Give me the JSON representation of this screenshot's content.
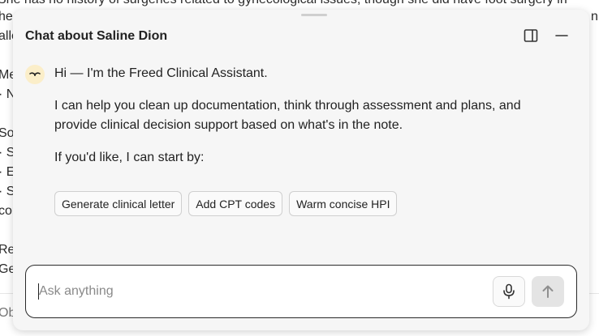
{
  "background": {
    "lines": [
      "She has no history of surgeries related to gynecological issues, though she did have foot surgery in",
      "he",
      "n",
      "alle",
      "Me",
      "· N",
      "So",
      "· S",
      "· E",
      "· S",
      "con",
      "Re",
      "Ge",
      "Ob"
    ]
  },
  "chat": {
    "title": "Chat about Saline Dion",
    "messages": {
      "greeting": "Hi — I'm the Freed Clinical Assistant.",
      "body": "I can help you clean up documentation, think through assessment and plans, and provide clinical decision support based on what's in the note.",
      "prompt": "If you'd like, I can start by:"
    },
    "suggestions": [
      "Generate clinical letter",
      "Add CPT codes",
      "Warm concise HPI"
    ],
    "input": {
      "placeholder": "Ask anything",
      "value": ""
    }
  },
  "colors": {
    "panel_bg": "#f6f6f6",
    "avatar_bg": "#fbeec9",
    "input_border": "#2a2a2a"
  },
  "icons": {
    "sidebar_toggle": "split-panel-icon",
    "minimize": "minimize-icon",
    "avatar": "freed-logo-icon",
    "mic": "microphone-icon",
    "send": "arrow-up-icon"
  }
}
